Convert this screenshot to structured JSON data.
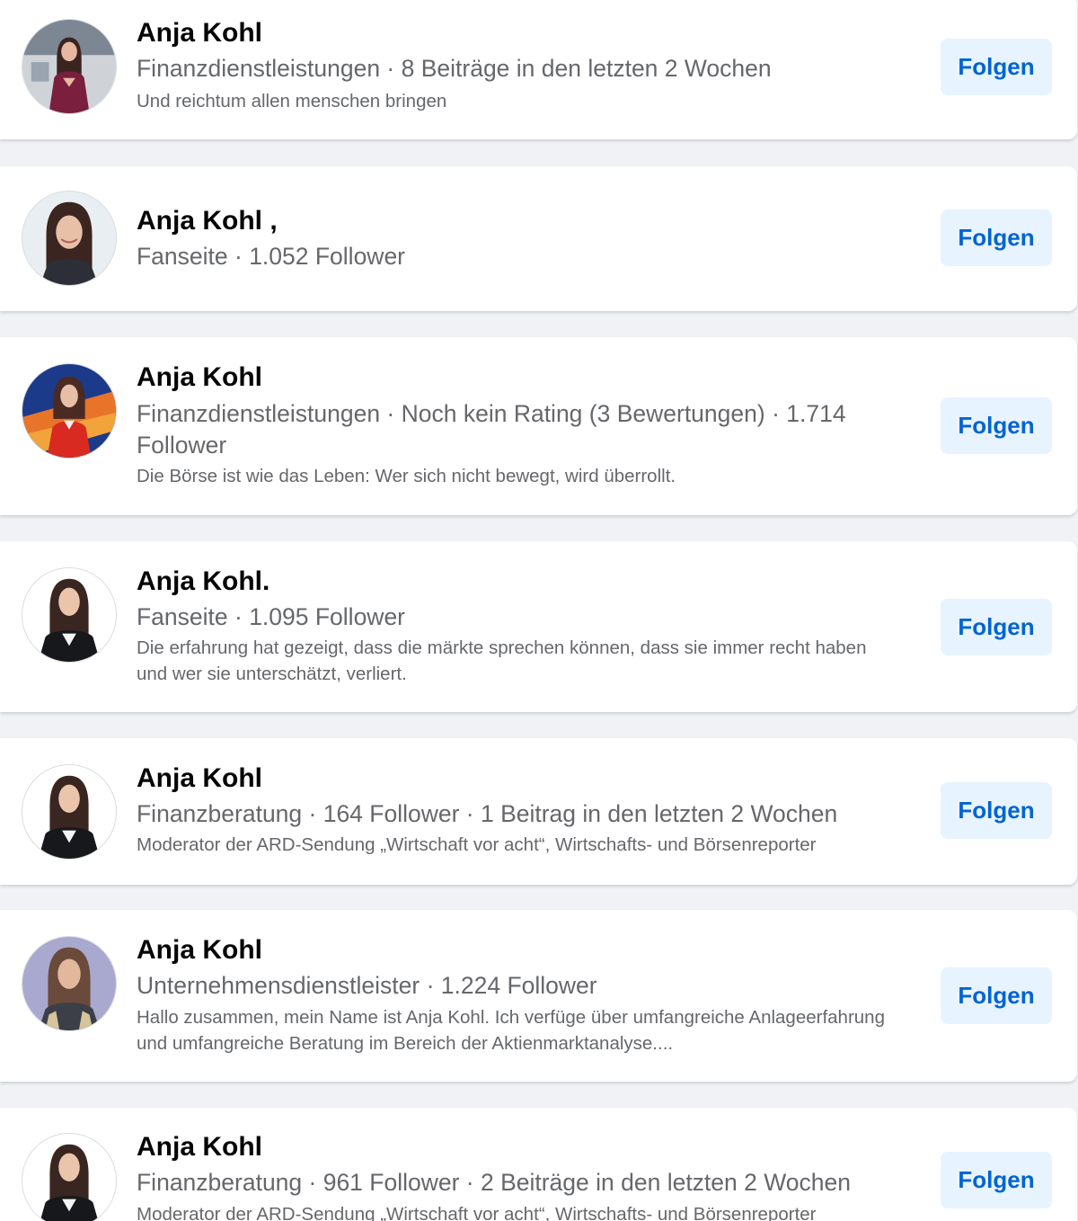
{
  "results": [
    {
      "name": "Anja Kohl",
      "meta": "Finanzdienstleistungen · 8 Beiträge in den letzten 2 Wochen",
      "description": "Und reichtum allen menschen bringen",
      "follow_label": "Folgen"
    },
    {
      "name": "Anja Kohl ,",
      "meta": "Fanseite · 1.052 Follower",
      "description": "",
      "follow_label": "Folgen"
    },
    {
      "name": "Anja Kohl",
      "meta": "Finanzdienstleistungen · Noch kein Rating (3 Bewertungen) · 1.714 Follower",
      "description": "Die Börse ist wie das Leben: Wer sich nicht bewegt, wird überrollt.",
      "follow_label": "Folgen"
    },
    {
      "name": "Anja Kohl.",
      "meta": "Fanseite · 1.095 Follower",
      "description": "Die erfahrung hat gezeigt, dass die märkte sprechen können, dass sie immer recht haben und wer sie unterschätzt, verliert.",
      "follow_label": "Folgen"
    },
    {
      "name": "Anja Kohl",
      "meta": "Finanzberatung · 164 Follower · 1 Beitrag in den letzten 2 Wochen",
      "description": "Moderator der ARD-Sendung „Wirtschaft vor acht“, Wirtschafts- und Börsenreporter",
      "follow_label": "Folgen"
    },
    {
      "name": "Anja Kohl",
      "meta": "Unternehmensdienstleister · 1.224 Follower",
      "description": "Hallo zusammen, mein Name ist Anja Kohl. Ich verfüge über umfangreiche Anlageerfahrung und umfangreiche Beratung im Bereich der Aktienmarktanalyse....",
      "follow_label": "Folgen"
    },
    {
      "name": "Anja Kohl",
      "meta": "Finanzberatung · 961 Follower · 2 Beiträge in den letzten 2 Wochen",
      "description": "Moderator der ARD-Sendung „Wirtschaft vor acht“, Wirtschafts- und Börsenreporter",
      "follow_label": "Folgen"
    }
  ],
  "colors": {
    "page_background": "#f0f2f5",
    "card_background": "#ffffff",
    "name_text": "#050505",
    "secondary_text": "#65676b",
    "button_background": "#e7f3ff",
    "button_text": "#0064d1"
  },
  "icons": {
    "avatar": "profile-photo"
  }
}
